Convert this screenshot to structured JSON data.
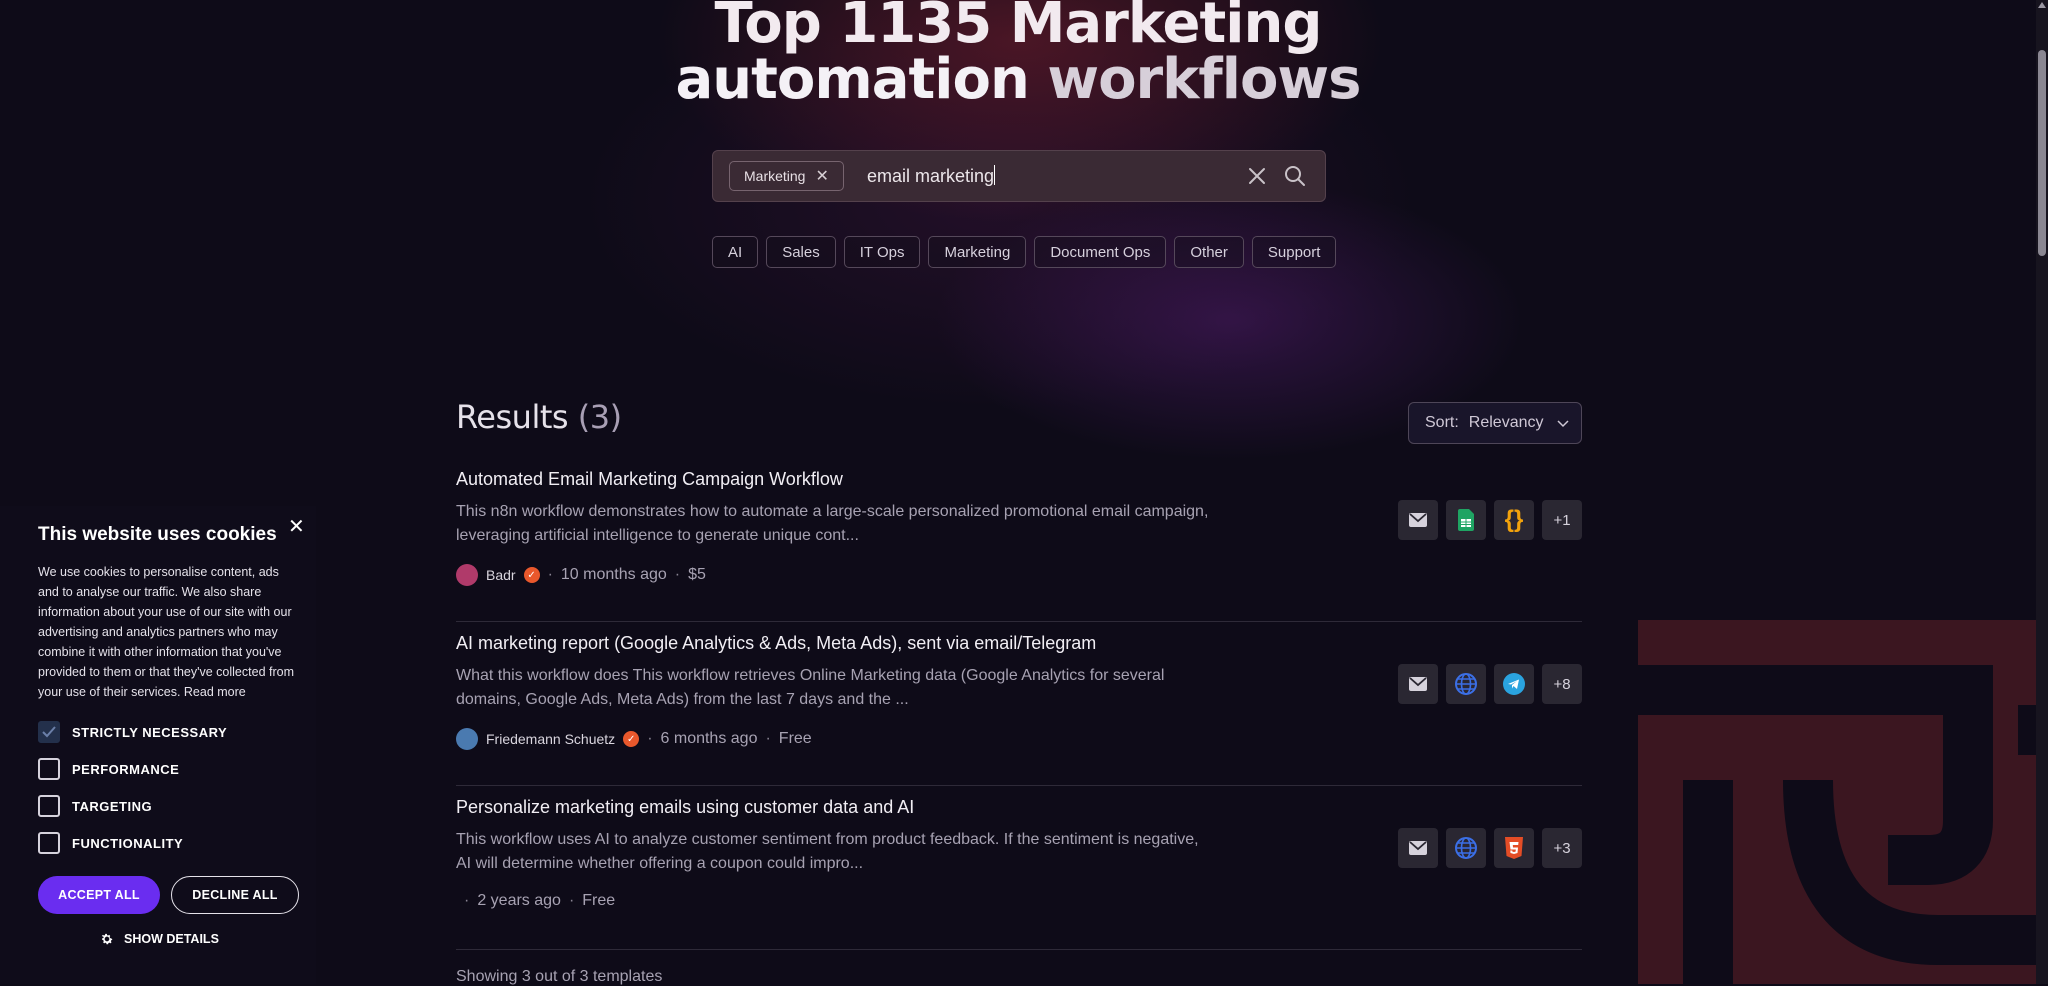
{
  "hero": {
    "line1": "Top 1135 Marketing",
    "line2_a": "automation",
    "line2_b": "workflows"
  },
  "search": {
    "chip_label": "Marketing",
    "query": "email marketing"
  },
  "categories": [
    "AI",
    "Sales",
    "IT Ops",
    "Marketing",
    "Document Ops",
    "Other",
    "Support"
  ],
  "results_header": {
    "label": "Results",
    "count": "(3)",
    "sort_label": "Sort:",
    "sort_value": "Relevancy"
  },
  "results": [
    {
      "title": "Automated Email Marketing Campaign Workflow",
      "desc": "This n8n workflow demonstrates how to automate a large-scale personalized promotional email campaign, leveraging artificial intelligence to generate unique cont...",
      "author": "Badr",
      "age": "10 months ago",
      "price": "$5",
      "more": "+1"
    },
    {
      "title": "AI marketing report (Google Analytics & Ads, Meta Ads), sent via email/Telegram",
      "desc": "What this workflow does This workflow retrieves Online Marketing data (Google Analytics for several domains, Google Ads, Meta Ads) from the last 7 days and the ...",
      "author": "Friedemann Schuetz",
      "age": "6 months ago",
      "price": "Free",
      "more": "+8"
    },
    {
      "title": "Personalize marketing emails using customer data and AI",
      "desc": "This workflow uses AI to analyze customer sentiment from product feedback. If the sentiment is negative, AI will determine whether offering a coupon could impro...",
      "author": "",
      "age": "2 years ago",
      "price": "Free",
      "more": "+3"
    }
  ],
  "footer": {
    "showing": "Showing 3 out of 3 templates"
  },
  "cookie": {
    "title": "This website uses cookies",
    "body": "We use cookies to personalise content, ads and to analyse our traffic. We also share information about your use of our site with our advertising and analytics partners who may combine it with other information that you've provided to them or that they've collected from your use of their services.",
    "read_more": "Read more",
    "options": [
      "STRICTLY NECESSARY",
      "PERFORMANCE",
      "TARGETING",
      "FUNCTIONALITY"
    ],
    "accept": "ACCEPT ALL",
    "decline": "DECLINE ALL",
    "show_details": "SHOW DETAILS"
  },
  "colors": {
    "accent": "#6a2df0",
    "verified": "#e9582c",
    "background": "#0e0b18"
  }
}
